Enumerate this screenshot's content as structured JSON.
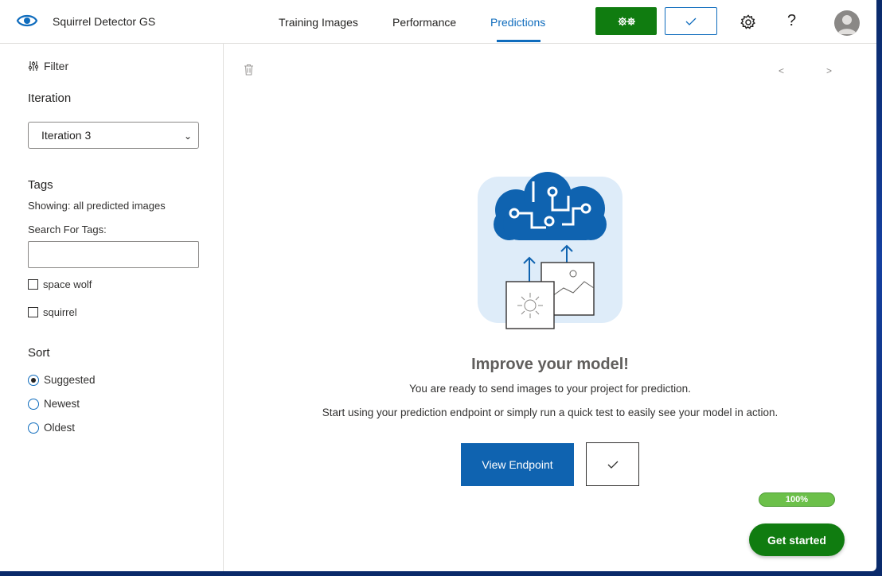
{
  "header": {
    "app_title": "Squirrel Detector GS",
    "tabs": [
      {
        "label": "Training Images",
        "active": false
      },
      {
        "label": "Performance",
        "active": false
      },
      {
        "label": "Predictions",
        "active": true
      }
    ],
    "train_icon": "gears-icon",
    "quick_test_icon": "check-icon",
    "settings_icon": "gear-icon",
    "help_label": "?",
    "avatar_icon": "user-avatar-icon"
  },
  "sidebar": {
    "filter_label": "Filter",
    "iteration_title": "Iteration",
    "iteration_selected": "Iteration 3",
    "tags_title": "Tags",
    "tags_showing": "Showing: all predicted images",
    "search_tags_label": "Search For Tags:",
    "search_tags_value": "",
    "tags": [
      {
        "label": "space wolf",
        "checked": false
      },
      {
        "label": "squirrel",
        "checked": false
      }
    ],
    "sort_title": "Sort",
    "sort_options": [
      {
        "label": "Suggested",
        "checked": true
      },
      {
        "label": "Newest",
        "checked": false
      },
      {
        "label": "Oldest",
        "checked": false
      }
    ]
  },
  "main": {
    "prev_label": "<",
    "next_label": ">",
    "headline": "Improve your model!",
    "line1": "You are ready to send images to your project for prediction.",
    "line2": "Start using your prediction endpoint or simply run a quick test to easily see your model in action.",
    "view_endpoint_label": "View Endpoint",
    "progress_label": "100%",
    "progress_value": 1.0,
    "get_started_label": "Get started"
  },
  "colors": {
    "accent": "#0f6cbd",
    "success": "#107c10",
    "progress": "#6cc04a"
  }
}
